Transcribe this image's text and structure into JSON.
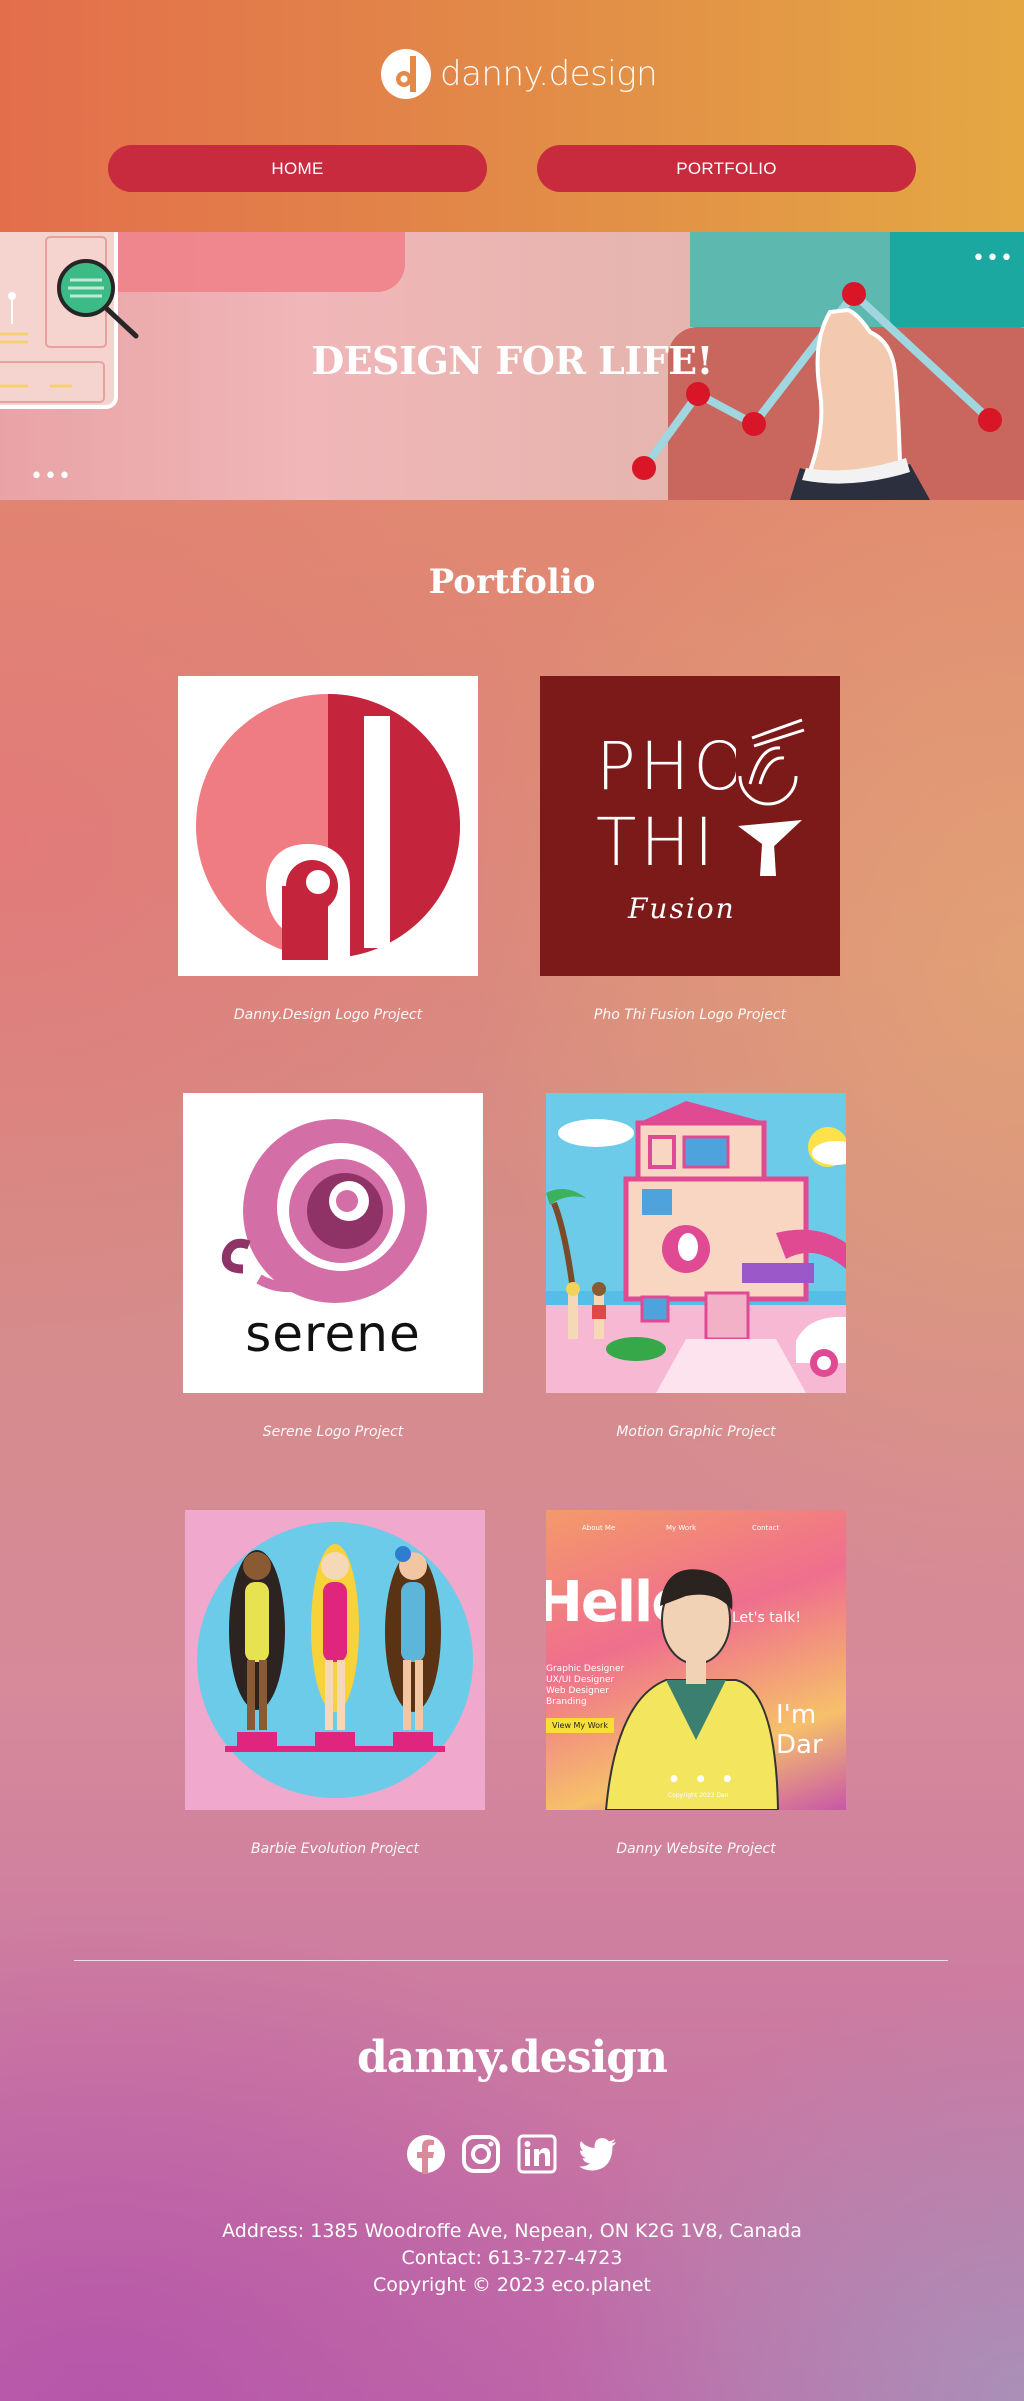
{
  "header": {
    "logo_text": "danny.design",
    "nav": [
      {
        "label": "HOME"
      },
      {
        "label": "PORTFOLIO"
      }
    ]
  },
  "hero": {
    "title": "DESIGN FOR LIFE!"
  },
  "portfolio": {
    "title": "Portfolio",
    "projects": [
      {
        "caption": "Danny.Design Logo Project"
      },
      {
        "caption": "Pho Thi Fusion Logo Project",
        "logo_line1": "PHO",
        "logo_line2": "THI",
        "logo_script": "Fusion"
      },
      {
        "caption": "Serene Logo Project",
        "logo_text": "serene"
      },
      {
        "caption": "Motion Graphic Project"
      },
      {
        "caption": "Barbie Evolution Project"
      },
      {
        "caption": "Danny Website Project",
        "nav_items": [
          "About Me",
          "My Work",
          "Contact"
        ],
        "hello": "Hello",
        "talk": "Let's talk!",
        "roles": [
          "Graphic Designer",
          "UX/UI Designer",
          "Web Designer",
          "Branding"
        ],
        "cta": "View My Work",
        "name_partial": "I'm Dar",
        "copyright": "Copyright 2023 Dan"
      }
    ]
  },
  "footer": {
    "brand": "danny.design",
    "social_icons": [
      "facebook-icon",
      "instagram-icon",
      "linkedin-icon",
      "twitter-icon"
    ],
    "address": "Address: 1385 Woodroffe Ave, Nepean, ON K2G 1V8, Canada",
    "contact": "Contact: 613-727-4723",
    "copyright": "Copyright © 2023 eco.planet"
  },
  "colors": {
    "nav_button": "#c82a3e",
    "header_start": "#e36e4c",
    "header_end": "#e4a843",
    "pho_bg": "#7b1a18",
    "danny_logo_pink": "#f07c83",
    "danny_logo_red": "#c5243d"
  }
}
